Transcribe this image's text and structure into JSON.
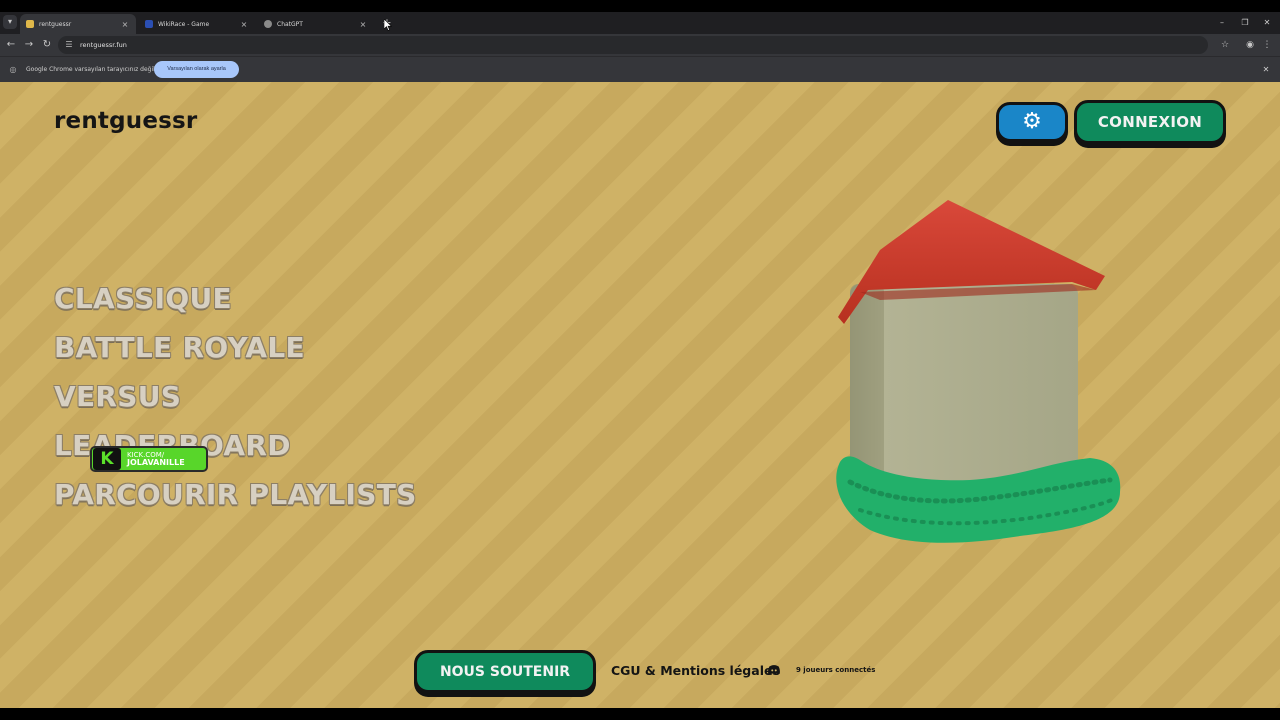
{
  "browser": {
    "tabs": [
      {
        "label": "rentguessr",
        "favicon_color": "#e0b84a",
        "active": true
      },
      {
        "label": "WikiRace - Game",
        "favicon_color": "#2b4fb3",
        "active": false
      },
      {
        "label": "ChatGPT",
        "favicon_color": "#8a8a8a",
        "active": false
      }
    ],
    "new_tab_symbol": "+",
    "tab_close_symbol": "×",
    "url": "rentguessr.fun",
    "infobar": {
      "message": "Google Chrome varsayılan tarayıcınız değil",
      "button_label": "Varsayılan olarak ayarla"
    }
  },
  "page": {
    "logo": "rentguessr",
    "header": {
      "settings_icon": "gear-icon",
      "login_label": "CONNEXION"
    },
    "menu": [
      {
        "label": "CLASSIQUE"
      },
      {
        "label": "BATTLE ROYALE"
      },
      {
        "label": "VERSUS"
      },
      {
        "label": "LEADERBOARD"
      },
      {
        "label": "PARCOURIR PLAYLISTS"
      }
    ],
    "kick_overlay": {
      "line1": "KICK.COM/",
      "line2": "JOLAVANILLE"
    },
    "footer": {
      "support_label": "NOUS SOUTENIR",
      "legal_label": "CGU & Mentions légales",
      "online_text": "9 joueurs connectés"
    }
  },
  "colors": {
    "background_stripe_a": "#c7a95e",
    "background_stripe_b": "#cfb266",
    "primary_green": "#0f8a5c",
    "settings_blue": "#1a86c8",
    "roof_red": "#c83a2a",
    "wall_color": "#a8a98a",
    "grass_green": "#22b06a"
  }
}
